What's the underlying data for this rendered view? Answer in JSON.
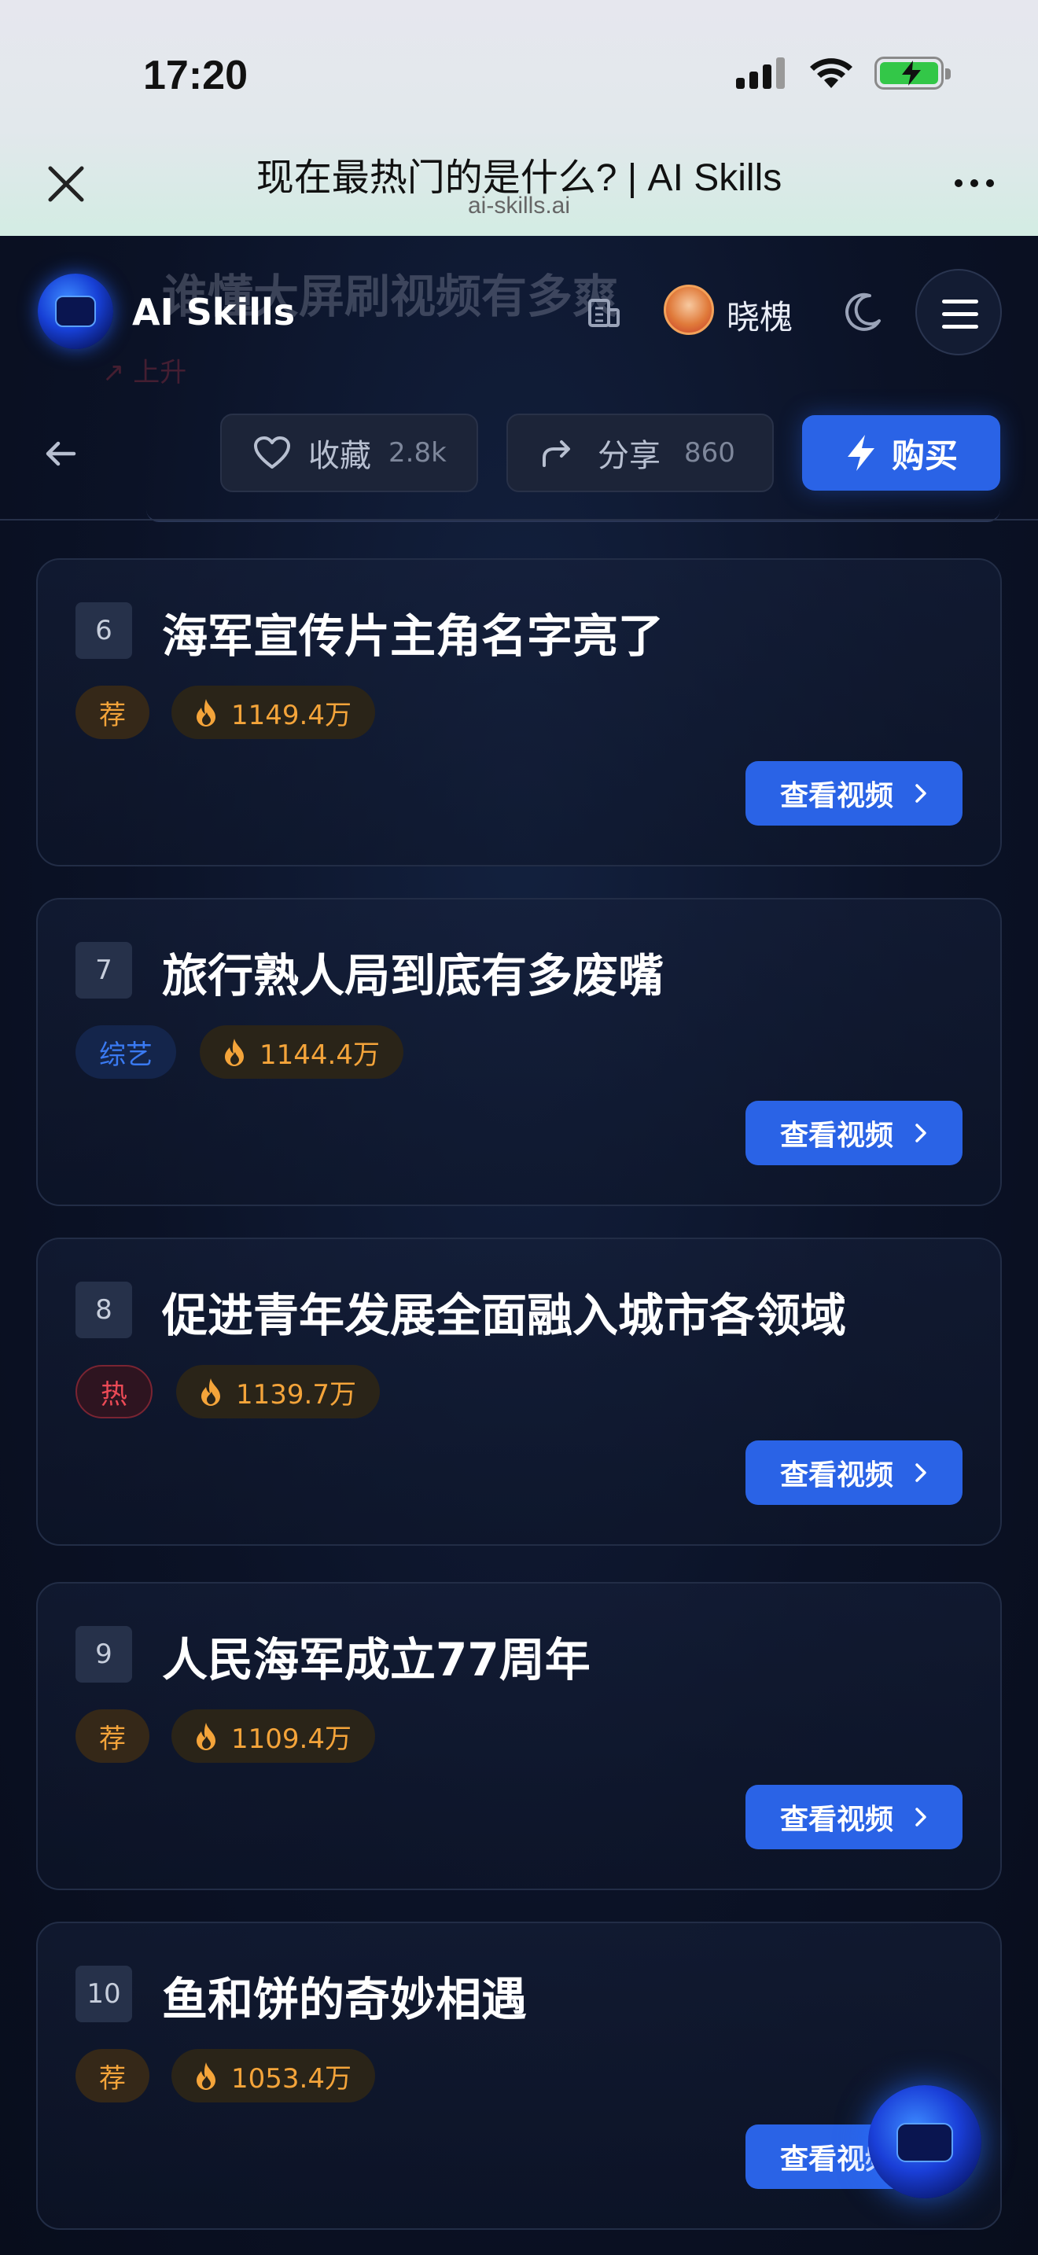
{
  "status_bar": {
    "time": "17:20"
  },
  "browser": {
    "title": "现在最热门的是什么? | AI Skills",
    "url": "ai-skills.ai"
  },
  "header": {
    "brand": "AI Skills",
    "user_name": "晓槐",
    "ghost_title": "谁懂大屏刷视频有多爽",
    "ghost_trend": "上升"
  },
  "actions": {
    "favorite_label": "收藏",
    "favorite_count": "2.8k",
    "share_label": "分享",
    "share_count": "860",
    "buy_label": "购买"
  },
  "view_button_label": "查看视频",
  "items": [
    {
      "rank": "6",
      "title": "海军宣传片主角名字亮了",
      "tag": "荐",
      "tag_type": "rec",
      "heat": "1149.4万"
    },
    {
      "rank": "7",
      "title": "旅行熟人局到底有多废嘴",
      "tag": "综艺",
      "tag_type": "variety",
      "heat": "1144.4万"
    },
    {
      "rank": "8",
      "title": "促进青年发展全面融入城市各领域",
      "tag": "热",
      "tag_type": "hot",
      "heat": "1139.7万"
    },
    {
      "rank": "9",
      "title": "人民海军成立77周年",
      "tag": "荐",
      "tag_type": "rec",
      "heat": "1109.4万"
    },
    {
      "rank": "10",
      "title": "鱼和饼的奇妙相遇",
      "tag": "荐",
      "tag_type": "rec",
      "heat": "1053.4万"
    }
  ],
  "colors": {
    "accent": "#2a63e6",
    "rec": "#f4a43a",
    "variety": "#3a7af2",
    "hot": "#ec4a56",
    "background": "#0a1022"
  }
}
